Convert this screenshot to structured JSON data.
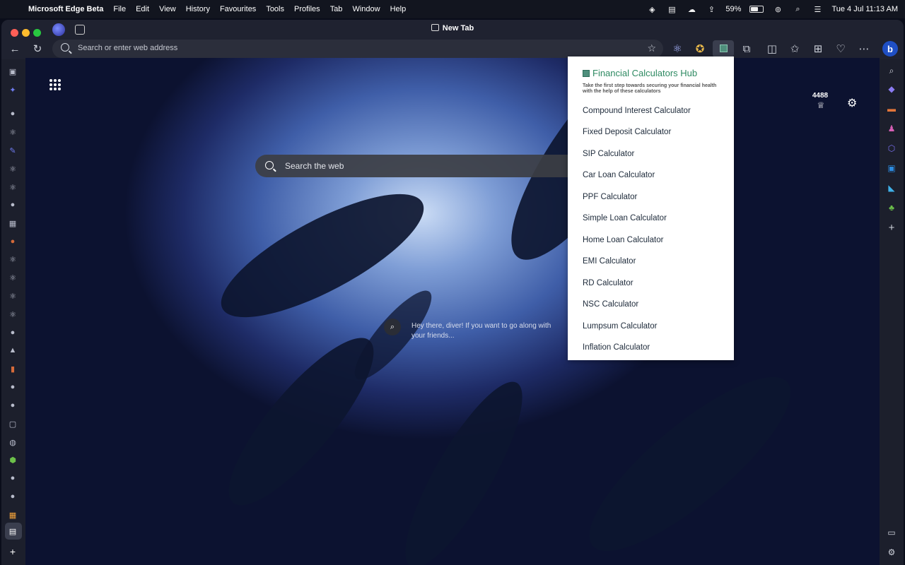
{
  "menubar": {
    "app_name": "Microsoft Edge Beta",
    "menus": [
      "File",
      "Edit",
      "View",
      "History",
      "Favourites",
      "Tools",
      "Profiles",
      "Tab",
      "Window",
      "Help"
    ],
    "battery": "59%",
    "battery_level": 0.59,
    "datetime": "Tue 4 Jul  11:13 AM"
  },
  "browser": {
    "tab_title": "New Tab",
    "address_placeholder": "Search or enter web address"
  },
  "newtab": {
    "search_placeholder": "Search the web",
    "fact_text": "Hey there, diver! If you want to go along with your friends...",
    "rewards_count": "4488"
  },
  "popup": {
    "title": "Financial Calculators Hub",
    "subtitle": "Take the first step towards securing your financial health with the help of these calculators",
    "calculators": [
      "Compound Interest Calculator",
      "Fixed Deposit Calculator",
      "SIP Calculator",
      "Car Loan Calculator",
      "PPF Calculator",
      "Simple Loan Calculator",
      "Home Loan Calculator",
      "EMI Calculator",
      "RD Calculator",
      "NSC Calculator",
      "Lumpsum Calculator",
      "Inflation Calculator"
    ],
    "accent_color": "#2e8a62"
  }
}
